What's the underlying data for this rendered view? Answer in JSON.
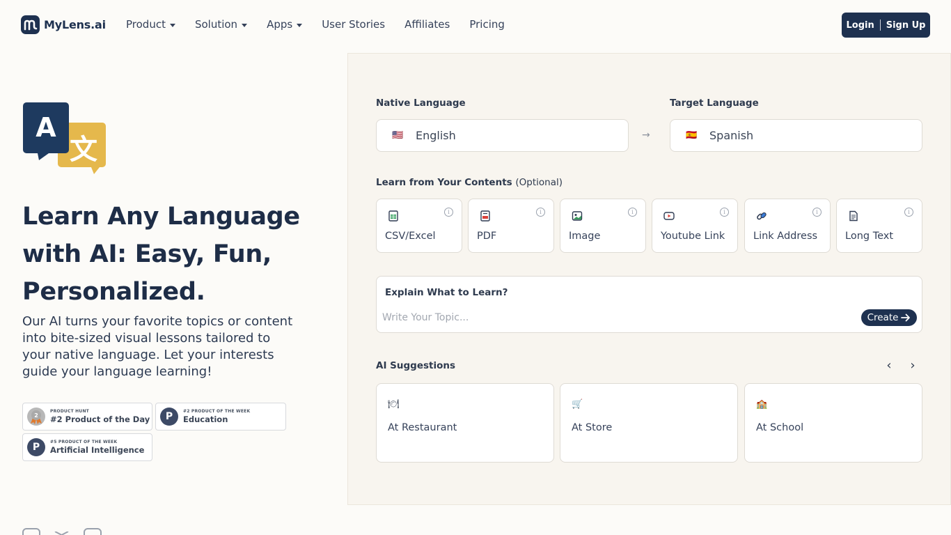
{
  "header": {
    "logo_text": "MyLens.ai",
    "nav": [
      {
        "label": "Product",
        "dropdown": true
      },
      {
        "label": "Solution",
        "dropdown": true
      },
      {
        "label": "Apps",
        "dropdown": true
      },
      {
        "label": "User Stories",
        "dropdown": false
      },
      {
        "label": "Affiliates",
        "dropdown": false
      },
      {
        "label": "Pricing",
        "dropdown": false
      }
    ],
    "login_label": "Login",
    "signup_label": "Sign Up"
  },
  "hero": {
    "title_line1": "Learn Any Language",
    "title_line2": "with AI: Easy, Fun,",
    "title_line3": "Personalized.",
    "description": "Our AI turns your favorite topics or content into bite-sized visual lessons tailored to your native language. Let your interests guide your language learning!",
    "badges": [
      {
        "small": "PRODUCT HUNT",
        "big": "#2 Product of the Day"
      },
      {
        "small": "#2 PRODUCT OF THE WEEK",
        "big": "Education"
      },
      {
        "small": "#5 PRODUCT OF THE WEEK",
        "big": "Artificial Intelligence"
      }
    ]
  },
  "panel": {
    "native_label": "Native Language",
    "target_label": "Target Language",
    "native_flag": "🇺🇸",
    "native_value": "English",
    "target_flag": "🇪🇸",
    "target_value": "Spanish",
    "contents_label": "Learn from Your Contents",
    "contents_optional": "(Optional)",
    "content_sources": [
      {
        "label": "CSV/Excel",
        "icon": "spreadsheet-icon"
      },
      {
        "label": "PDF",
        "icon": "pdf-icon"
      },
      {
        "label": "Image",
        "icon": "image-icon"
      },
      {
        "label": "Youtube Link",
        "icon": "youtube-icon"
      },
      {
        "label": "Link Address",
        "icon": "link-icon"
      },
      {
        "label": "Long Text",
        "icon": "document-icon"
      }
    ],
    "explain_title": "Explain What to Learn?",
    "explain_placeholder": "Write Your Topic...",
    "create_label": "Create",
    "suggestions_title": "AI Suggestions",
    "suggestions": [
      {
        "emoji": "🍽",
        "label": "At Restaurant"
      },
      {
        "emoji": "🛒",
        "label": "At Store"
      },
      {
        "emoji": "🏫",
        "label": "At School"
      }
    ]
  }
}
